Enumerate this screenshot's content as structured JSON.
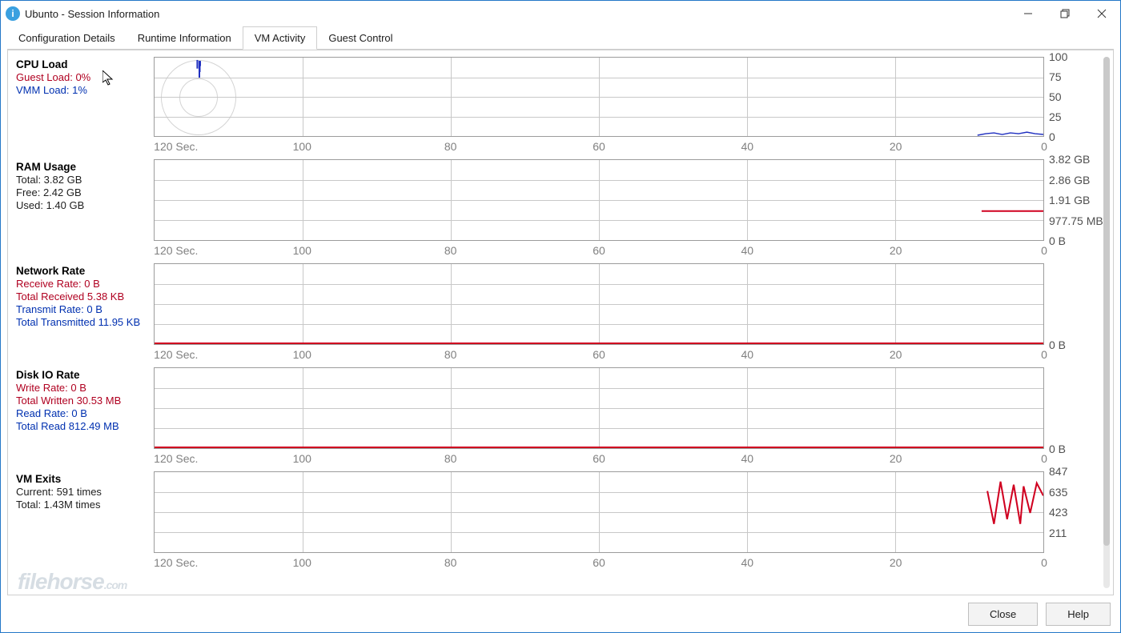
{
  "window": {
    "title": "Ubunto - Session Information"
  },
  "tabs": {
    "config": "Configuration Details",
    "runtime": "Runtime Information",
    "vmactivity": "VM Activity",
    "guest": "Guest Control"
  },
  "chart_data": [
    {
      "id": "cpu",
      "title": "CPU Load",
      "type": "line",
      "xlabel": "Sec.",
      "x_ticks": [
        120,
        100,
        80,
        60,
        40,
        20,
        0
      ],
      "y_ticks": [
        "100",
        "75",
        "50",
        "25",
        "0"
      ],
      "ylim": [
        0,
        100
      ],
      "series": [
        {
          "name": "Guest Load",
          "color_key": "red"
        },
        {
          "name": "VMM Load",
          "color_key": "blue"
        }
      ],
      "legend": [
        {
          "text": "Guest Load: 0%",
          "color": "red"
        },
        {
          "text": "VMM Load: 1%",
          "color": "blue"
        }
      ],
      "note": "VMM line hovers near 0–3% at right edge"
    },
    {
      "id": "ram",
      "title": "RAM Usage",
      "type": "line",
      "xlabel": "Sec.",
      "x_ticks": [
        120,
        100,
        80,
        60,
        40,
        20,
        0
      ],
      "y_ticks": [
        "3.82 GB",
        "2.86 GB",
        "1.91 GB",
        "977.75 MB",
        "0 B"
      ],
      "ylim": [
        0,
        3.82
      ],
      "series": [
        {
          "name": "Used",
          "color_key": "red",
          "approx_value_gb": 1.4
        }
      ],
      "legend": [
        {
          "text": "Total: 3.82 GB",
          "color": "black"
        },
        {
          "text": "Free: 2.42 GB",
          "color": "black"
        },
        {
          "text": "Used: 1.40 GB",
          "color": "black"
        }
      ]
    },
    {
      "id": "net",
      "title": "Network Rate",
      "type": "line",
      "xlabel": "Sec.",
      "x_ticks": [
        120,
        100,
        80,
        60,
        40,
        20,
        0
      ],
      "y_ticks": [
        "0 B"
      ],
      "ylim": [
        0,
        0
      ],
      "series": [
        {
          "name": "Receive Rate",
          "color_key": "red",
          "value": "0 B"
        },
        {
          "name": "Transmit Rate",
          "color_key": "blue",
          "value": "0 B"
        }
      ],
      "legend": [
        {
          "text": "Receive Rate: 0 B",
          "color": "red"
        },
        {
          "text": "Total Received 5.38 KB",
          "color": "red"
        },
        {
          "text": "Transmit Rate: 0 B",
          "color": "blue"
        },
        {
          "text": "Total Transmitted 11.95 KB",
          "color": "blue"
        }
      ]
    },
    {
      "id": "disk",
      "title": "Disk IO Rate",
      "type": "line",
      "xlabel": "Sec.",
      "x_ticks": [
        120,
        100,
        80,
        60,
        40,
        20,
        0
      ],
      "y_ticks": [
        "0 B"
      ],
      "ylim": [
        0,
        0
      ],
      "series": [
        {
          "name": "Write Rate",
          "color_key": "red",
          "value": "0 B"
        },
        {
          "name": "Read Rate",
          "color_key": "blue",
          "value": "0 B"
        }
      ],
      "legend": [
        {
          "text": "Write Rate: 0 B",
          "color": "red"
        },
        {
          "text": "Total Written 30.53 MB",
          "color": "red"
        },
        {
          "text": "Read Rate: 0 B",
          "color": "blue"
        },
        {
          "text": "Total Read 812.49 MB",
          "color": "blue"
        }
      ]
    },
    {
      "id": "exits",
      "title": "VM Exits",
      "type": "line",
      "xlabel": "Sec.",
      "x_ticks": [
        120,
        100,
        80,
        60,
        40,
        20,
        0
      ],
      "y_ticks": [
        "847",
        "635",
        "423",
        "211"
      ],
      "ylim": [
        0,
        847
      ],
      "series": [
        {
          "name": "Current",
          "color_key": "red"
        }
      ],
      "legend": [
        {
          "text": "Current: 591 times",
          "color": "black"
        },
        {
          "text": "Total: 1.43M times",
          "color": "black"
        }
      ],
      "sample_points": [
        650,
        300,
        750,
        350,
        720,
        300,
        700,
        420,
        591
      ]
    }
  ],
  "buttons": {
    "close": "Close",
    "help": "Help"
  },
  "watermark": {
    "main": "filehorse",
    "ext": ".com"
  },
  "axis_first_label_suffix": " Sec."
}
